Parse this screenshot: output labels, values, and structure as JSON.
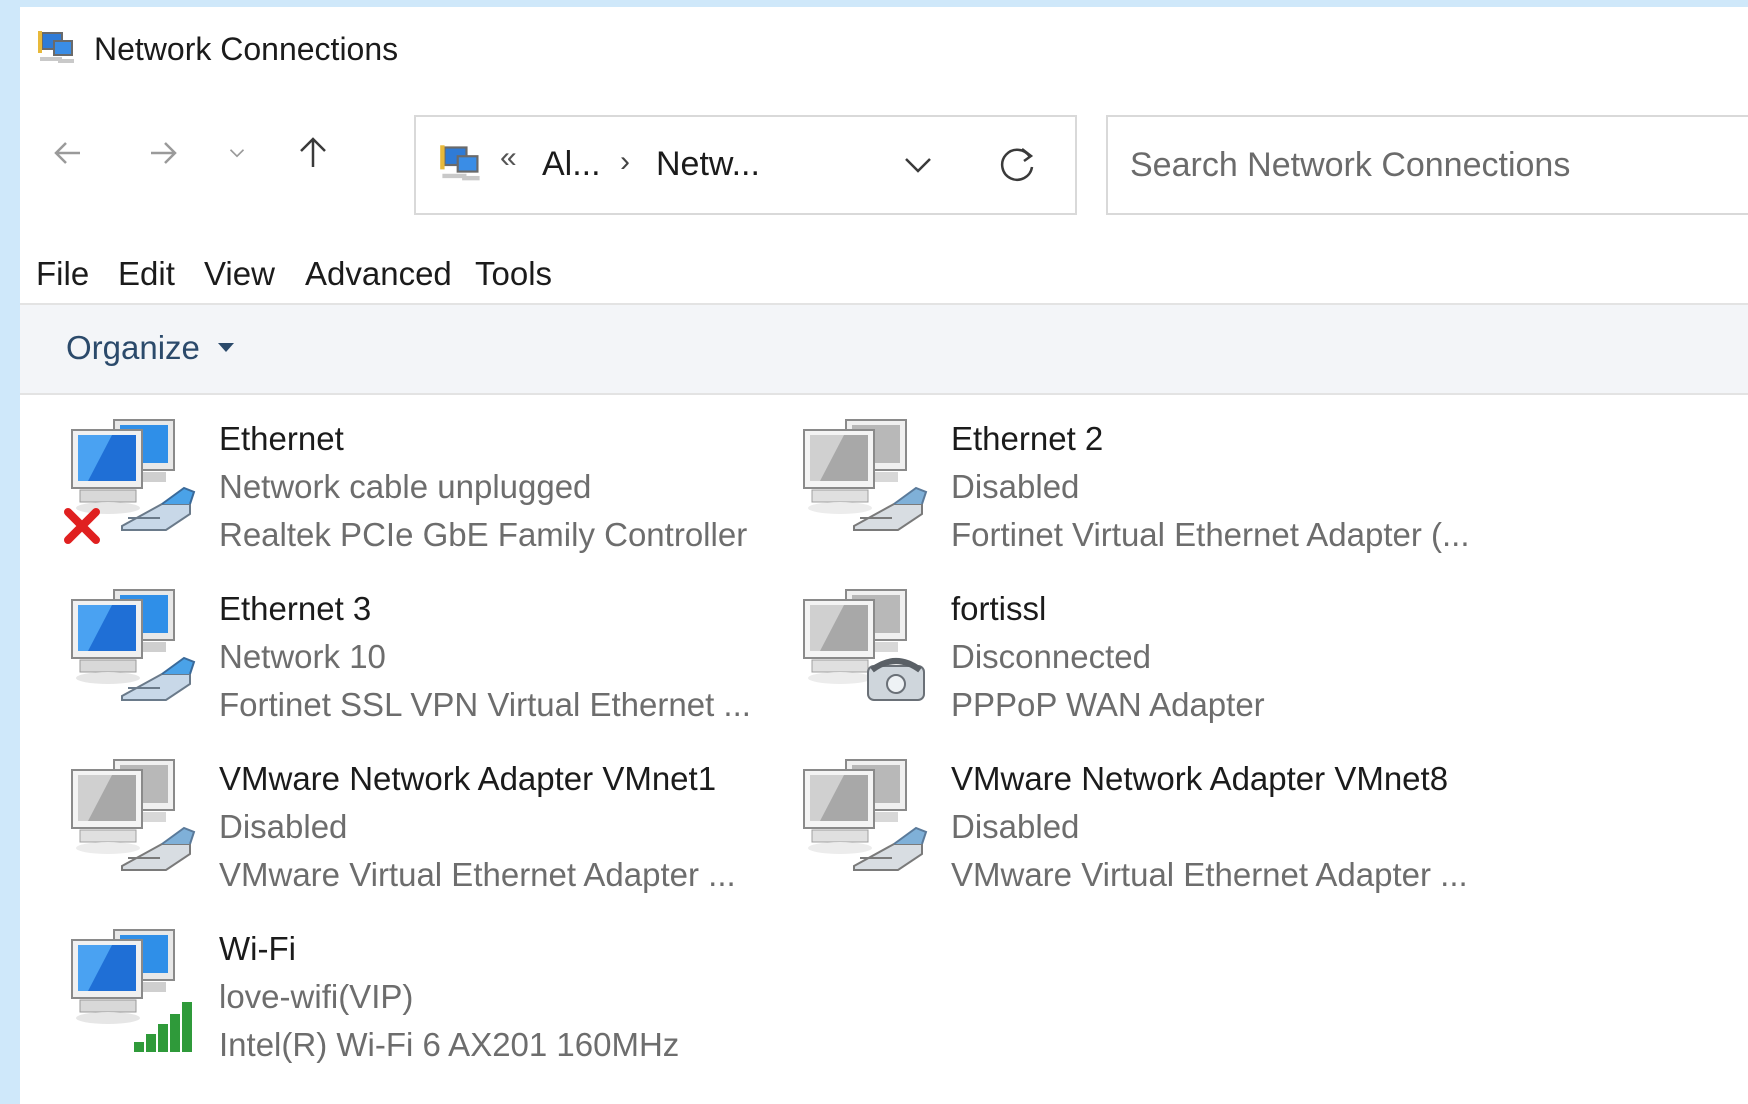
{
  "window": {
    "title": "Network Connections"
  },
  "address": {
    "overflow": "«",
    "segments": [
      "Al...",
      "Netw..."
    ],
    "separator": "›"
  },
  "search": {
    "placeholder": "Search Network Connections"
  },
  "menu": [
    "File",
    "Edit",
    "View",
    "Advanced",
    "Tools"
  ],
  "command_bar": {
    "organize_label": "Organize"
  },
  "connections": [
    {
      "name": "Ethernet",
      "status": "Network cable unplugged",
      "device": "Realtek PCIe GbE Family Controller",
      "icon": "ethernet-unplugged-icon",
      "enabled": true
    },
    {
      "name": "Ethernet 2",
      "status": "Disabled",
      "device": "Fortinet Virtual Ethernet Adapter (...",
      "icon": "ethernet-disabled-icon",
      "enabled": false
    },
    {
      "name": "Ethernet 3",
      "status": "Network 10",
      "device": "Fortinet SSL VPN Virtual Ethernet ...",
      "icon": "ethernet-connected-icon",
      "enabled": true
    },
    {
      "name": "fortissl",
      "status": "Disconnected",
      "device": "PPPoP WAN Adapter",
      "icon": "dialup-disconnected-icon",
      "enabled": false
    },
    {
      "name": "VMware Network Adapter VMnet1",
      "status": "Disabled",
      "device": "VMware Virtual Ethernet Adapter ...",
      "icon": "ethernet-disabled-icon",
      "enabled": false
    },
    {
      "name": "VMware Network Adapter VMnet8",
      "status": "Disabled",
      "device": "VMware Virtual Ethernet Adapter ...",
      "icon": "ethernet-disabled-icon",
      "enabled": false
    },
    {
      "name": "Wi-Fi",
      "status": "love-wifi(VIP)",
      "device": "Intel(R) Wi-Fi 6 AX201 160MHz",
      "icon": "wifi-connected-icon",
      "enabled": true
    }
  ]
}
